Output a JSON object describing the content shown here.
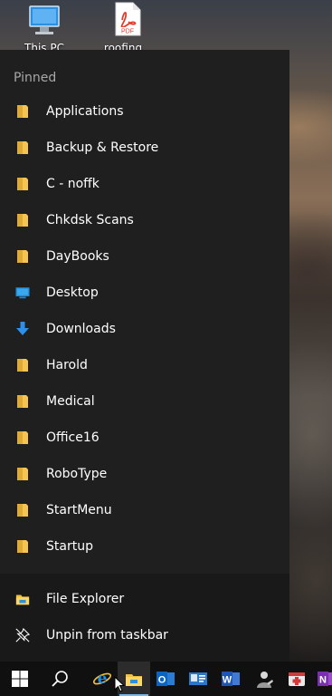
{
  "desktop": {
    "icons": [
      {
        "label": "This PC",
        "icon": "this-pc-icon"
      },
      {
        "label": "roofing",
        "icon": "pdf-file-icon",
        "badge": "PDF"
      }
    ]
  },
  "jumplist": {
    "section_title": "Pinned",
    "pinned": [
      {
        "label": "Applications",
        "icon": "folder-icon"
      },
      {
        "label": "Backup & Restore",
        "icon": "folder-icon"
      },
      {
        "label": "C - noffk",
        "icon": "folder-icon"
      },
      {
        "label": "Chkdsk Scans",
        "icon": "folder-icon"
      },
      {
        "label": "DayBooks",
        "icon": "folder-icon"
      },
      {
        "label": "Desktop",
        "icon": "desktop-icon"
      },
      {
        "label": "Downloads",
        "icon": "downloads-icon"
      },
      {
        "label": "Harold",
        "icon": "folder-icon"
      },
      {
        "label": "Medical",
        "icon": "folder-icon"
      },
      {
        "label": "Office16",
        "icon": "folder-icon"
      },
      {
        "label": "RoboType",
        "icon": "folder-icon"
      },
      {
        "label": "StartMenu",
        "icon": "folder-icon"
      },
      {
        "label": "Startup",
        "icon": "folder-icon"
      }
    ],
    "actions": [
      {
        "label": "File Explorer",
        "icon": "file-explorer-icon"
      },
      {
        "label": "Unpin from taskbar",
        "icon": "unpin-icon"
      }
    ]
  },
  "taskbar": {
    "items": [
      {
        "icon": "windows-start-icon"
      },
      {
        "icon": "search-icon"
      },
      {
        "icon": "internet-explorer-icon"
      },
      {
        "icon": "file-explorer-icon",
        "active": true
      },
      {
        "icon": "outlook-icon",
        "letter": "O"
      },
      {
        "icon": "contacts-card-icon"
      },
      {
        "icon": "word-icon",
        "letter": "W"
      },
      {
        "icon": "user-app-icon"
      },
      {
        "icon": "medical-app-icon"
      },
      {
        "icon": "onenote-icon",
        "letter": "N"
      }
    ]
  },
  "colors": {
    "folder": "#f5c453",
    "accent": "#76b9ed",
    "menu_bg": "#1f1f1f",
    "taskbar_bg": "#101010"
  }
}
